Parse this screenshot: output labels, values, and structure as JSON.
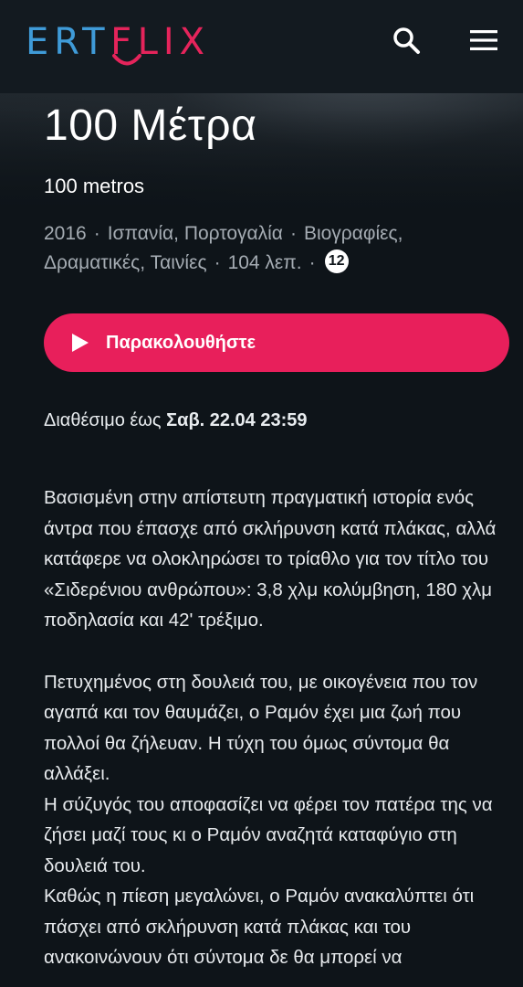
{
  "brand": {
    "logo_left": "ERT",
    "logo_mid": "F",
    "logo_right": "LIX",
    "color_ert": "#3f9bd8",
    "color_flix": "#e5245b"
  },
  "header": {
    "search_icon": "search-icon",
    "menu_icon": "hamburger-menu-icon"
  },
  "movie": {
    "title": "100 Μέτρα",
    "original_title": "100 metros",
    "year": "2016",
    "countries": "Ισπανία, Πορτογαλία",
    "genres_line1": "Βιογραφίες,",
    "genres_line2": "Δραματικές, Ταινίες",
    "duration": "104 λεπ.",
    "age_rating": "12",
    "separator": "·"
  },
  "watch_button": {
    "label": "Παρακολουθήστε",
    "color": "#e81f5b"
  },
  "availability": {
    "prefix": "Διαθέσιμο έως",
    "date": "Σαβ. 22.04 23:59"
  },
  "description": {
    "p1": "Βασισμένη στην απίστευτη πραγματική ιστορία ενός άντρα που έπασχε από σκλήρυνση κατά πλάκας, αλλά κατάφερε να ολοκληρώσει το τρίαθλο για τον τίτλο του «Σιδερένιου ανθρώπου»: 3,8 χλμ κολύμβηση, 180 χλμ ποδηλασία και 42' τρέξιμο.",
    "p2": "Πετυχημένος στη δουλειά του, με οικογένεια που τον αγαπά και τον θαυμάζει, ο Ραμόν έχει μια ζωή που πολλοί θα ζήλευαν. Η τύχη του όμως σύντομα θα αλλάξει.",
    "p3": "Η σύζυγός του αποφασίζει να φέρει τον πατέρα της να ζήσει μαζί τους κι ο Ραμόν αναζητά καταφύγιο στη δουλειά του.",
    "p4": "Καθώς η πίεση μεγαλώνει, ο Ραμόν ανακαλύπτει ότι πάσχει από σκλήρυνση κατά πλάκας και του ανακοινώνουν ότι σύντομα δε θα μπορεί να"
  }
}
